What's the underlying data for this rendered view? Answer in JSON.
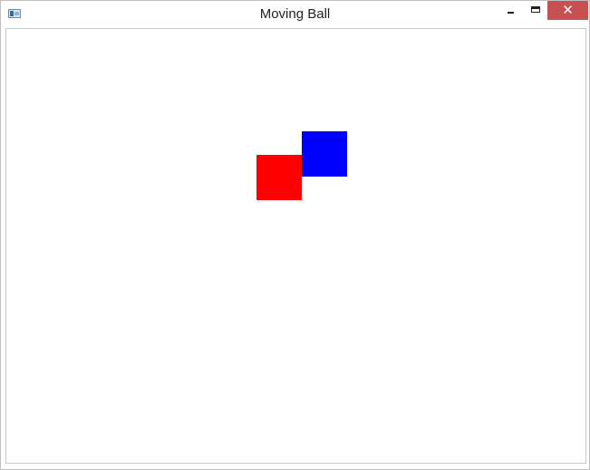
{
  "window": {
    "title": "Moving Ball",
    "controls": {
      "minimize_icon": "minimize-icon",
      "maximize_icon": "maximize-icon",
      "close_glyph": "✕"
    },
    "colors": {
      "close_background": "#c75050",
      "canvas_background": "#ffffff"
    }
  },
  "canvas": {
    "shapes": [
      {
        "name": "red-square",
        "color": "#ff0000"
      },
      {
        "name": "blue-square",
        "color": "#0000ff"
      }
    ]
  }
}
